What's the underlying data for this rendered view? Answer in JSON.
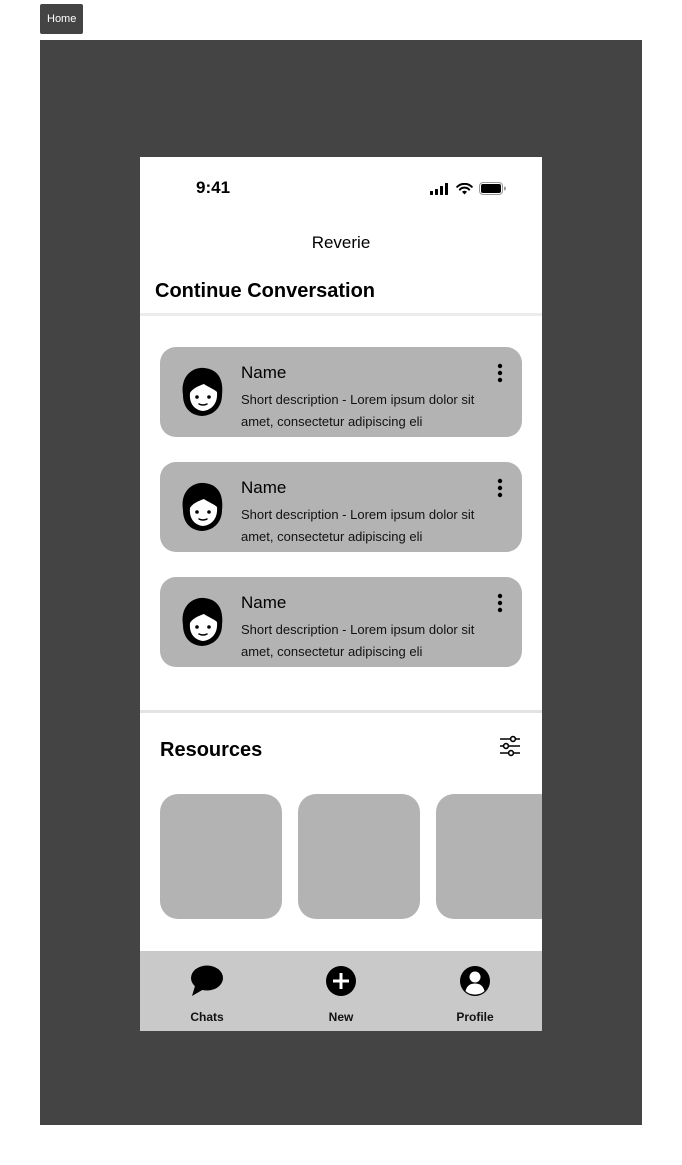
{
  "frame": {
    "tab_label": "Home"
  },
  "status_bar": {
    "time": "9:41"
  },
  "header": {
    "app_title": "Reverie",
    "section_title": "Continue Conversation"
  },
  "conversations": [
    {
      "name": "Name",
      "description": "Short description - Lorem ipsum dolor sit amet, consectetur adipiscing eli"
    },
    {
      "name": "Name",
      "description": "Short description - Lorem ipsum dolor sit amet, consectetur adipiscing eli"
    },
    {
      "name": "Name",
      "description": "Short description - Lorem ipsum dolor sit amet, consectetur adipiscing eli"
    }
  ],
  "resources": {
    "title": "Resources",
    "filter_icon": "sliders-icon"
  },
  "tabbar": {
    "tabs": [
      {
        "label": "Chats",
        "icon": "chat-bubble-icon"
      },
      {
        "label": "New",
        "icon": "plus-circle-icon"
      },
      {
        "label": "Profile",
        "icon": "user-circle-icon"
      }
    ]
  },
  "colors": {
    "canvas": "#444444",
    "card": "#b3b3b3",
    "tabbar": "#c9c9c9"
  }
}
